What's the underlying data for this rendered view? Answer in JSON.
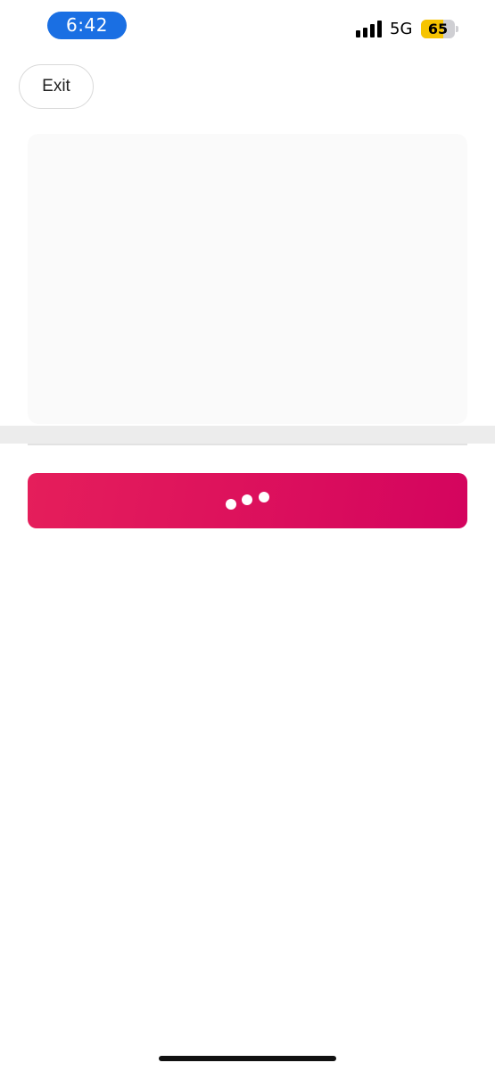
{
  "status_bar": {
    "time": "6:42",
    "time_pill_color": "#1a6fe3",
    "network": "5G",
    "signal_bars": 4,
    "battery_level": "65",
    "battery_fraction": 0.65,
    "battery_color": "#f6c400"
  },
  "header": {
    "exit_label": "Exit"
  },
  "content": {
    "card_color": "#fafafa"
  },
  "primary_action": {
    "state": "loading",
    "gradient_start": "#e51e5b",
    "gradient_end": "#d4045e",
    "icon": "loading-dots-icon"
  }
}
